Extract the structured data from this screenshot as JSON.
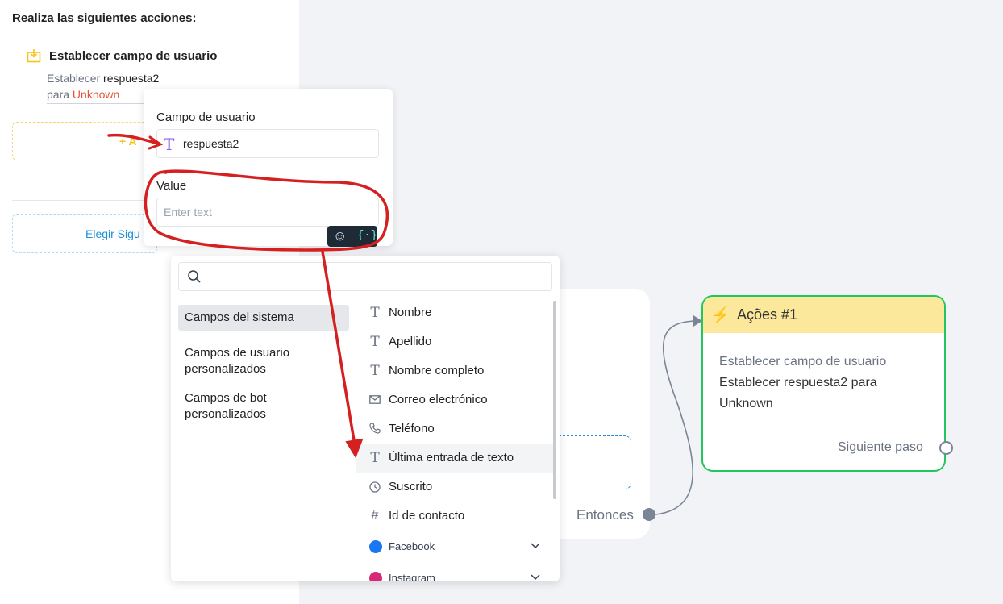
{
  "sidebar": {
    "heading": "Realiza las siguientes acciones:",
    "action_title": "Establecer campo de usuario",
    "action_desc_prefix": "Establecer",
    "action_desc_field": "respuesta2",
    "action_desc_para": "para",
    "action_desc_value": "Unknown",
    "add_action_label": "+ A",
    "next_step_label": "Elegir Sigu"
  },
  "popup": {
    "field_label": "Campo de usuario",
    "field_value": "respuesta2",
    "value_label": "Value",
    "value_placeholder": "Enter text",
    "emoji_glyph": "☺",
    "vars_glyph": "{·}"
  },
  "dropdown": {
    "categories": [
      {
        "line1": "Campos del sistema",
        "line2": ""
      },
      {
        "line1": "Campos de usuario",
        "line2": "personalizados"
      },
      {
        "line1": "Campos de bot",
        "line2": "personalizados"
      }
    ],
    "items": [
      {
        "icon": "text-icon",
        "label": "Nombre"
      },
      {
        "icon": "text-icon",
        "label": "Apellido"
      },
      {
        "icon": "text-icon",
        "label": "Nombre completo"
      },
      {
        "icon": "mail-icon",
        "label": "Correo electrónico"
      },
      {
        "icon": "phone-icon",
        "label": "Teléfono"
      },
      {
        "icon": "text-icon",
        "label": "Última entrada de texto"
      },
      {
        "icon": "clock-icon",
        "label": "Suscrito"
      },
      {
        "icon": "hash-icon",
        "label": "Id de contacto"
      },
      {
        "icon": "messenger-icon",
        "label": "Facebook"
      },
      {
        "icon": "instagram-icon",
        "label": "Instagram"
      }
    ]
  },
  "condition_node": {
    "then_label": "Entonces"
  },
  "actions_node": {
    "title": "Ações #1",
    "label": "Establecer campo de usuario",
    "body_line1": "Establecer respuesta2 para",
    "body_line2": "Unknown",
    "next_label": "Siguiente paso"
  },
  "colors": {
    "accent_green": "#22c55e",
    "header_yellow": "#fbe89a",
    "annotation_red": "#d42020",
    "link_blue": "#1d8fd8"
  }
}
